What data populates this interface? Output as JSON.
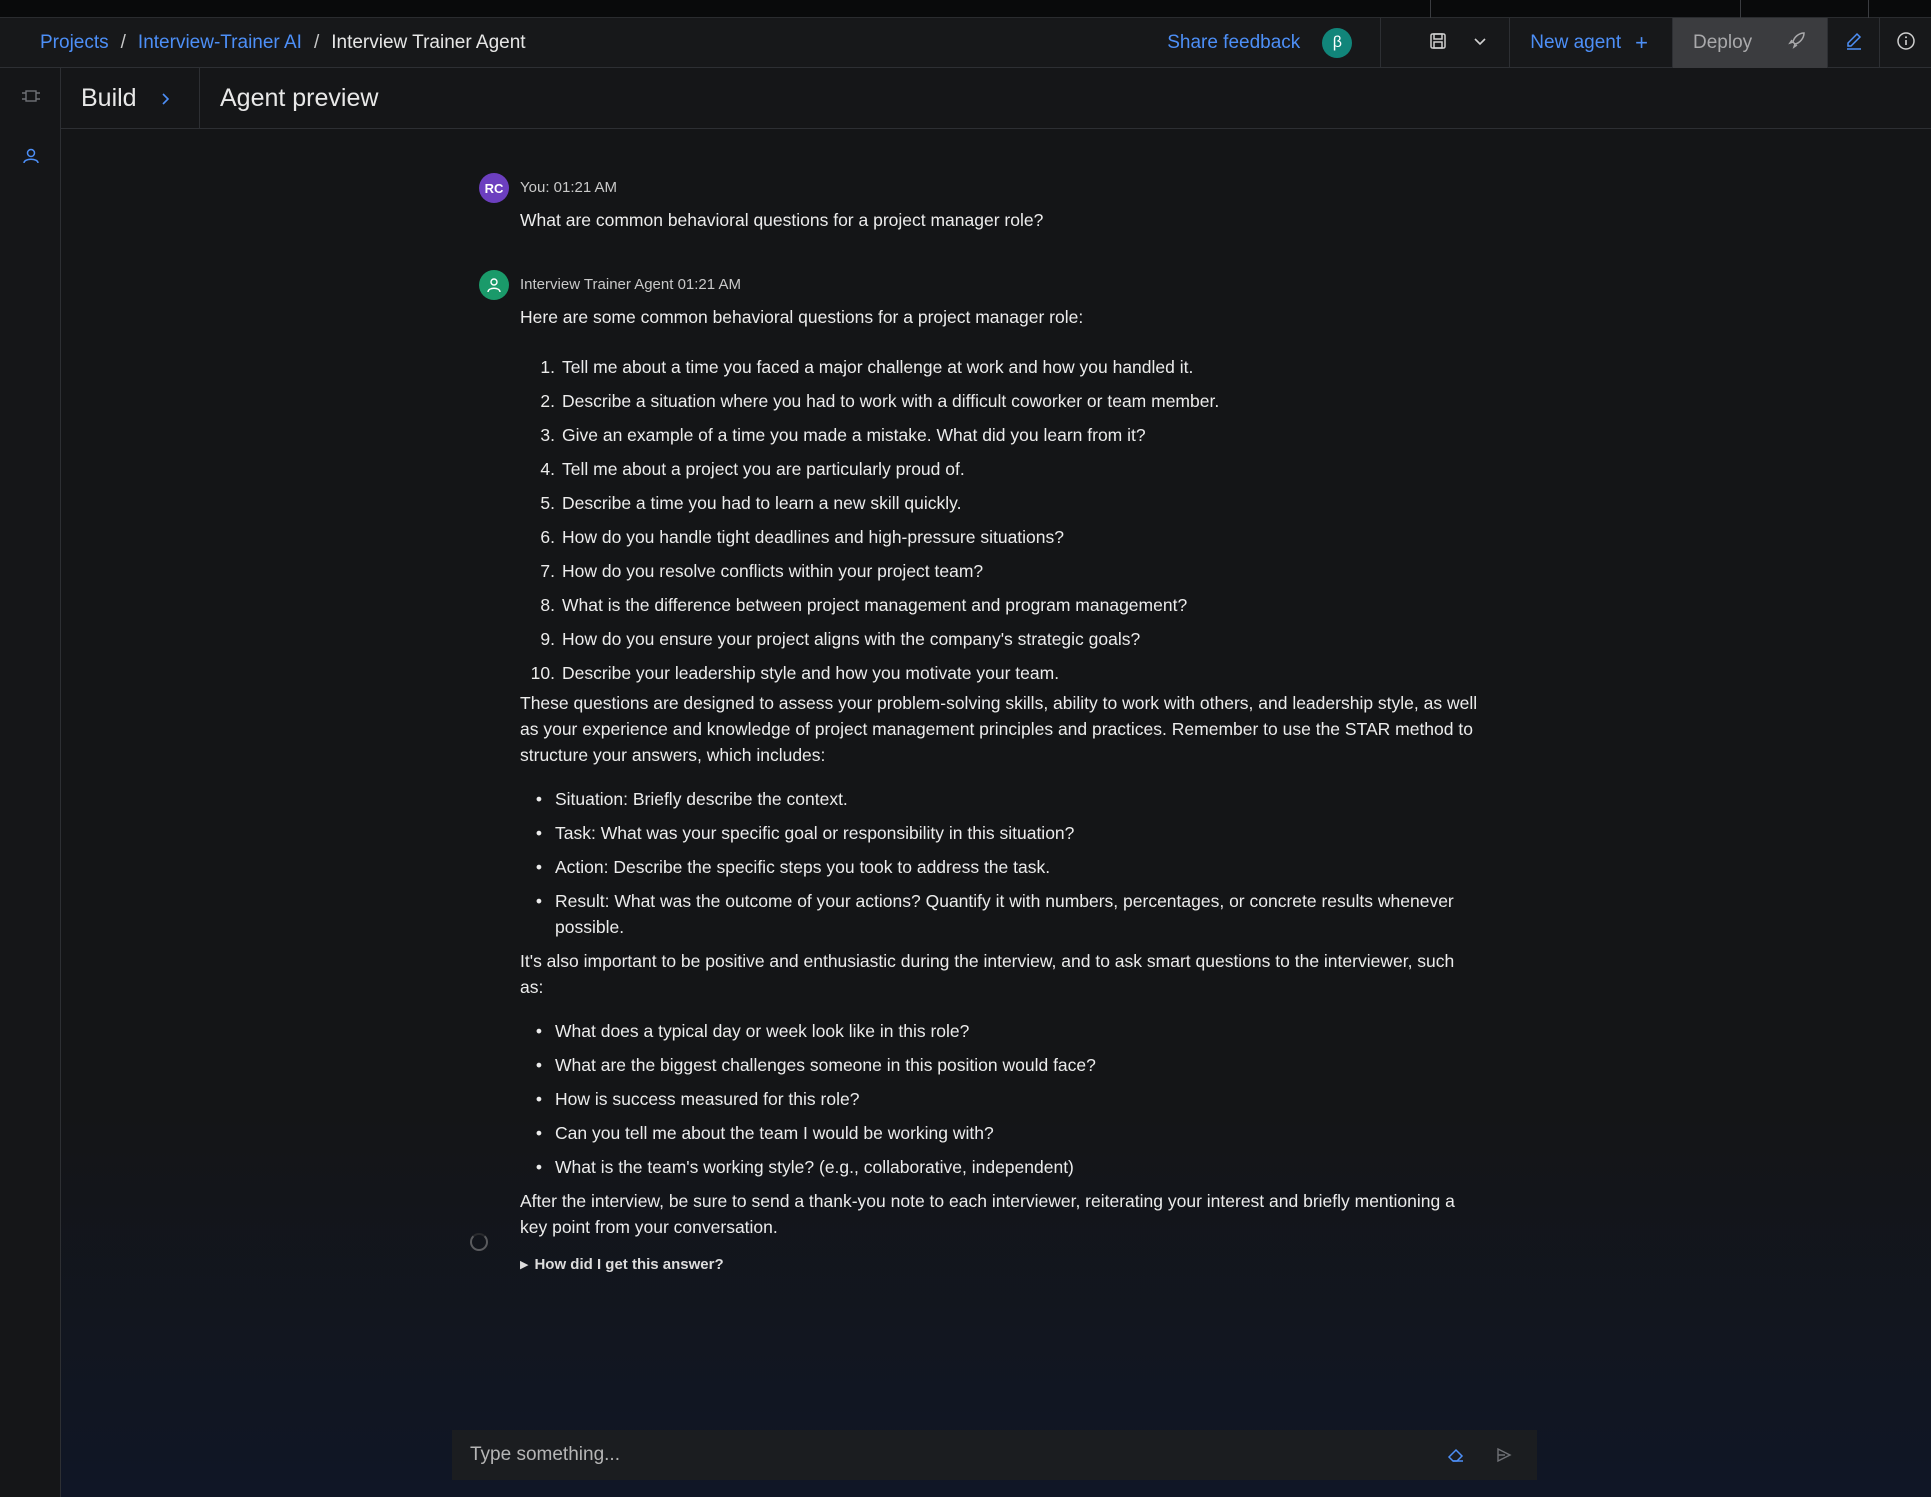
{
  "breadcrumb": {
    "items": [
      "Projects",
      "Interview-Trainer AI"
    ],
    "separator": "/",
    "current": "Interview Trainer Agent"
  },
  "toolbar": {
    "share_feedback": "Share feedback",
    "beta_badge": "β",
    "new_agent": "New agent",
    "new_agent_icon": "+",
    "deploy": "Deploy",
    "icons": [
      "save-icon",
      "chevron-down-icon",
      "plus-icon",
      "rocket-icon",
      "edit-icon",
      "info-icon"
    ]
  },
  "left_rail": {
    "icons": [
      "settings-panel-icon",
      "agent-icon"
    ]
  },
  "subheader": {
    "build": "Build",
    "title": "Agent preview"
  },
  "colors": {
    "link": "#4d8ff7",
    "beta": "#11857a",
    "user_avatar": "#6c3fbf",
    "agent_avatar": "#1a9a6a"
  },
  "chat": {
    "user_message": {
      "initials": "RC",
      "meta": "You: 01:21 AM",
      "text": "What are common behavioral questions for a project manager role?"
    },
    "agent_message": {
      "meta": "Interview Trainer Agent 01:21 AM",
      "intro": "Here are some common behavioral questions for a project manager role:",
      "questions": [
        {
          "num": "1.",
          "text": "Tell me about a time you faced a major challenge at work and how you handled it."
        },
        {
          "num": "2.",
          "text": "Describe a situation where you had to work with a difficult coworker or team member."
        },
        {
          "num": "3.",
          "text": "Give an example of a time you made a mistake. What did you learn from it?"
        },
        {
          "num": "4.",
          "text": "Tell me about a project you are particularly proud of."
        },
        {
          "num": "5.",
          "text": "Describe a time you had to learn a new skill quickly."
        },
        {
          "num": "6.",
          "text": "How do you handle tight deadlines and high-pressure situations?"
        },
        {
          "num": "7.",
          "text": "How do you resolve conflicts within your project team?"
        },
        {
          "num": "8.",
          "text": "What is the difference between project management and program management?"
        },
        {
          "num": "9.",
          "text": "How do you ensure your project aligns with the company's strategic goals?"
        },
        {
          "num": "10.",
          "text": "Describe your leadership style and how you motivate your team."
        }
      ],
      "para1": "These questions are designed to assess your problem-solving skills, ability to work with others, and leadership style, as well as your experience and knowledge of project management principles and practices. Remember to use the STAR method to structure your answers, which includes:",
      "star": [
        "Situation: Briefly describe the context.",
        "Task: What was your specific goal or responsibility in this situation?",
        "Action: Describe the specific steps you took to address the task.",
        "Result: What was the outcome of your actions? Quantify it with numbers, percentages, or concrete results whenever possible."
      ],
      "para2": "It's also important to be positive and enthusiastic during the interview, and to ask smart questions to the interviewer, such as:",
      "ask": [
        "What does a typical day or week look like in this role?",
        "What are the biggest challenges someone in this position would face?",
        "How is success measured for this role?",
        "Can you tell me about the team I would be working with?",
        "What is the team's working style? (e.g., collaborative, independent)"
      ],
      "para3": "After the interview, be sure to send a thank-you note to each interviewer, reiterating your interest and briefly mentioning a key point from your conversation.",
      "how_link": "How did I get this answer?"
    }
  },
  "input": {
    "placeholder": "Type something..."
  }
}
